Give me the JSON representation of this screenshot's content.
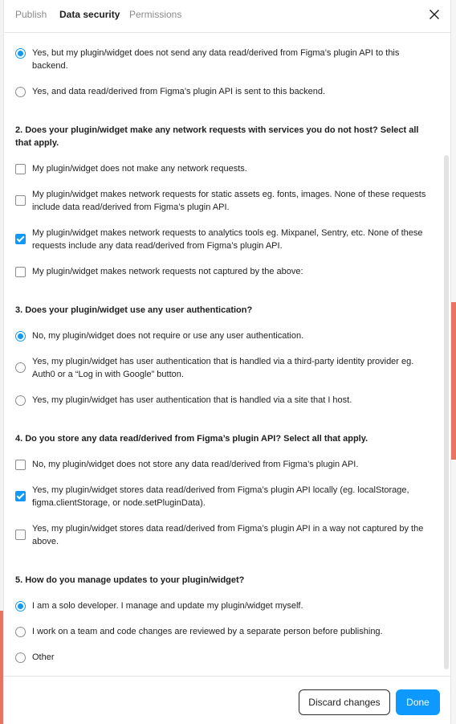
{
  "tabs": [
    {
      "label": "Publish"
    },
    {
      "label": "Data security"
    },
    {
      "label": "Permissions"
    }
  ],
  "q1": {
    "options": [
      {
        "label": "Yes, but my plugin/widget does not send any data read/derived from Figma’s plugin API to this backend.",
        "checked": true
      },
      {
        "label": "Yes, and data read/derived from Figma’s plugin API is sent to this backend.",
        "checked": false
      }
    ]
  },
  "q2": {
    "question": "2. Does your plugin/widget make any network requests with services you do not host? Select all that apply.",
    "options": [
      {
        "label": "My plugin/widget does not make any network requests.",
        "checked": false
      },
      {
        "label": "My plugin/widget makes network requests for static assets eg. fonts, images. None of these requests include data read/derived from Figma’s plugin API.",
        "checked": false
      },
      {
        "label": "My plugin/widget makes network requests to analytics tools eg. Mixpanel, Sentry, etc. None of these requests include any data read/derived from Figma’s plugin API.",
        "checked": true
      },
      {
        "label": "My plugin/widget makes network requests not captured by the above:",
        "checked": false
      }
    ]
  },
  "q3": {
    "question": "3. Does your plugin/widget use any user authentication?",
    "options": [
      {
        "label": "No, my plugin/widget does not require or use any user authentication.",
        "checked": true
      },
      {
        "label": "Yes, my plugin/widget has user authentication that is handled via a third-party identity provider eg. Auth0 or a “Log in with Google” button.",
        "checked": false
      },
      {
        "label": "Yes, my plugin/widget has user authentication that is handled via a site that I host.",
        "checked": false
      }
    ]
  },
  "q4": {
    "question": "4. Do you store any data read/derived from Figma’s plugin API? Select all that apply.",
    "options": [
      {
        "label": "No, my plugin/widget does not store any data read/derived from Figma’s plugin API.",
        "checked": false
      },
      {
        "label": "Yes, my plugin/widget stores data read/derived from Figma’s plugin API locally (eg. localStorage, figma.clientStorage, or node.setPluginData).",
        "checked": true
      },
      {
        "label": "Yes, my plugin/widget stores data read/derived from Figma’s plugin API in a way not captured by the above.",
        "checked": false
      }
    ]
  },
  "q5": {
    "question": "5. How do you manage updates to your plugin/widget?",
    "options": [
      {
        "label": "I am a solo developer. I manage and update my plugin/widget myself.",
        "checked": true
      },
      {
        "label": "I work on a team and code changes are reviewed by a separate person before publishing.",
        "checked": false
      },
      {
        "label": "Other",
        "checked": false
      }
    ]
  },
  "footer": {
    "discard_label": "Discard changes",
    "done_label": "Done"
  },
  "colors": {
    "accent": "#0d99ff",
    "background_accent": "#e8735e"
  },
  "icons": {
    "close": "close-icon"
  }
}
